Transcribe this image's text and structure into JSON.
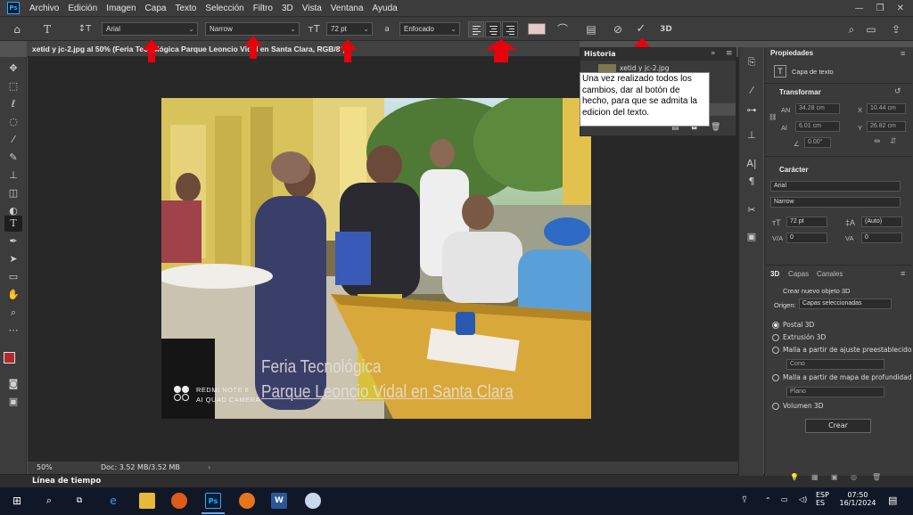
{
  "menubar": {
    "logo": "Ps",
    "items": [
      "Archivo",
      "Edición",
      "Imagen",
      "Capa",
      "Texto",
      "Selección",
      "Filtro",
      "3D",
      "Vista",
      "Ventana",
      "Ayuda"
    ]
  },
  "options": {
    "font_family": "Arial",
    "font_style": "Narrow",
    "font_size": "72 pt",
    "aa_label": "a",
    "antialias": "Enfocado",
    "threed_label": "3D"
  },
  "document": {
    "tab_title": "xetid y jc-2.jpg al 50% (Feria Tecnológica Parque Leoncio Vidal en Santa Clara, RGB/8*) *",
    "zoom": "50%",
    "doc_size": "Doc: 3.52 MB/3.52 MB",
    "text_line1": "Feria Tecnológica",
    "text_line2": "Parque Leoncio Vidal en Santa Clara",
    "watermark_line1": "REDMI NOTE 8",
    "watermark_line2": "AI QUAD CAMERA"
  },
  "history": {
    "title": "Historia",
    "item": "xetid y jc-2.jpg"
  },
  "note": "Una vez realizado todos los cambios, dar al botón de hecho, para que se admita la edicion del texto.",
  "timeline_label": "Línea de tiempo",
  "properties": {
    "tab": "Propiedades",
    "layer_type": "Capa de texto",
    "transform_title": "Transformar",
    "w": "34.28 cm",
    "x": "10.44 cm",
    "h": "6.01 cm",
    "y": "26.82 cm",
    "angle": "0.00°",
    "caracter_title": "Carácter",
    "font_family": "Arial",
    "font_style": "Narrow",
    "font_size": "72 pt",
    "leading": "(Auto)",
    "kerning": "0",
    "tracking": "0"
  },
  "panel3d": {
    "tabs": [
      "3D",
      "Capas",
      "Canales"
    ],
    "heading": "Crear nuevo objeto 3D",
    "origin_label": "Origen:",
    "origin_value": "Capas seleccionadas",
    "options": [
      "Postal 3D",
      "Extrusión 3D",
      "Malla a partir de ajuste preestablecido",
      "Malla a partir de mapa de profundidad",
      "Volumen 3D"
    ],
    "preset_value": "Cono",
    "depth_value": "Plano",
    "create_button": "Crear"
  },
  "taskbar": {
    "lang1": "ESP",
    "lang2": "ES",
    "time": "07:50",
    "date": "16/1/2024"
  }
}
